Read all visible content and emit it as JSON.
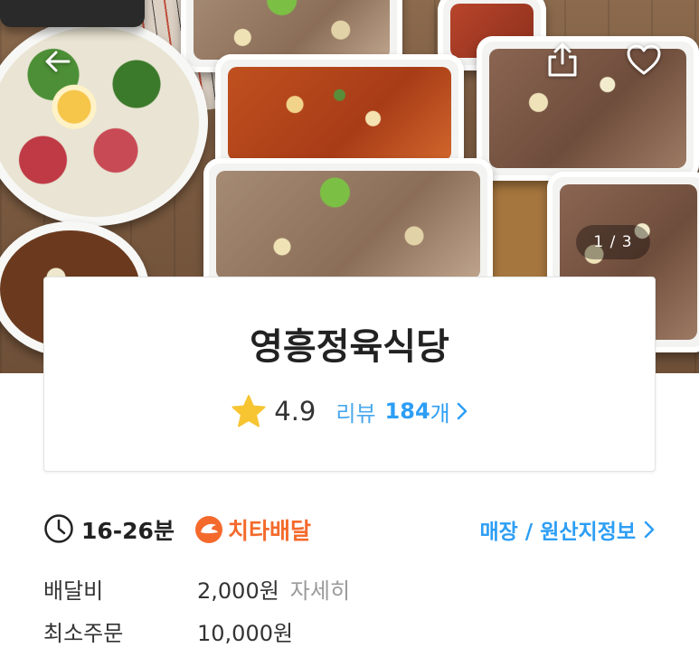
{
  "hero": {
    "pager": "1 / 3"
  },
  "store": {
    "name": "영흥정육식당",
    "rating": "4.9",
    "review_label": "리뷰",
    "review_count": "184",
    "review_unit": "개"
  },
  "delivery": {
    "time": "16-26분",
    "service_name": "치타배달",
    "store_info_link": "매장 / 원산지정보"
  },
  "fees": {
    "delivery_fee_label": "배달비",
    "delivery_fee_value": "2,000원",
    "delivery_fee_detail": "자세히",
    "min_order_label": "최소주문",
    "min_order_value": "10,000원"
  },
  "icons": {
    "back": "back-arrow-icon",
    "share": "share-icon",
    "favorite": "heart-icon",
    "star": "star-icon",
    "clock": "clock-icon",
    "cheetah": "cheetah-logo-icon"
  },
  "colors": {
    "link_blue": "#2d9ef5",
    "cheetah_orange": "#f46a2c",
    "star_yellow": "#f7c532",
    "muted_gray": "#9a9a9a"
  }
}
